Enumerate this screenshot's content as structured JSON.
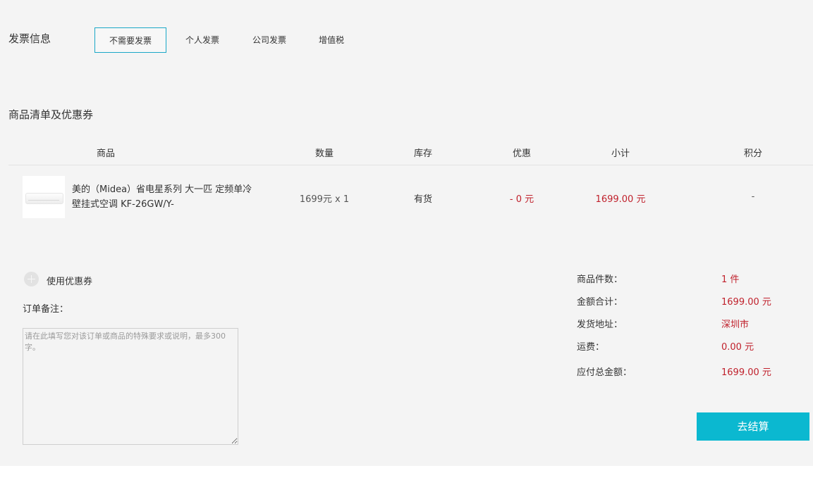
{
  "invoice": {
    "title": "发票信息",
    "options": [
      "不需要发票",
      "个人发票",
      "公司发票",
      "增值税"
    ]
  },
  "list": {
    "title": "商品清单及优惠券",
    "columns": [
      "商品",
      "数量",
      "库存",
      "优惠",
      "小计",
      "积分"
    ],
    "item": {
      "name": "美的（Midea）省电星系列 大一匹 定频单冷 壁挂式空调 KF-26GW/Y-",
      "quantity": "1699元 x 1",
      "stock": "有货",
      "discount": "- 0 元",
      "subtotal": "1699.00 元",
      "points": "-"
    }
  },
  "coupon": {
    "label": "使用优惠券"
  },
  "remark": {
    "label": "订单备注：",
    "placeholder": "请在此填写您对该订单或商品的特殊要求或说明，最多300字。"
  },
  "summary": {
    "items": [
      {
        "label": "商品件数：",
        "value": "1 件"
      },
      {
        "label": "金额合计：",
        "value": "1699.00 元"
      },
      {
        "label": "发货地址：",
        "value": "深圳市"
      },
      {
        "label": "运费：",
        "value": "0.00 元"
      },
      {
        "label": "应付总金额：",
        "value": "1699.00 元"
      }
    ]
  },
  "checkout": {
    "label": "去结算"
  },
  "colors": {
    "accent": "#0bb8d0",
    "price": "#c0212c",
    "background": "#f4f4f4"
  }
}
